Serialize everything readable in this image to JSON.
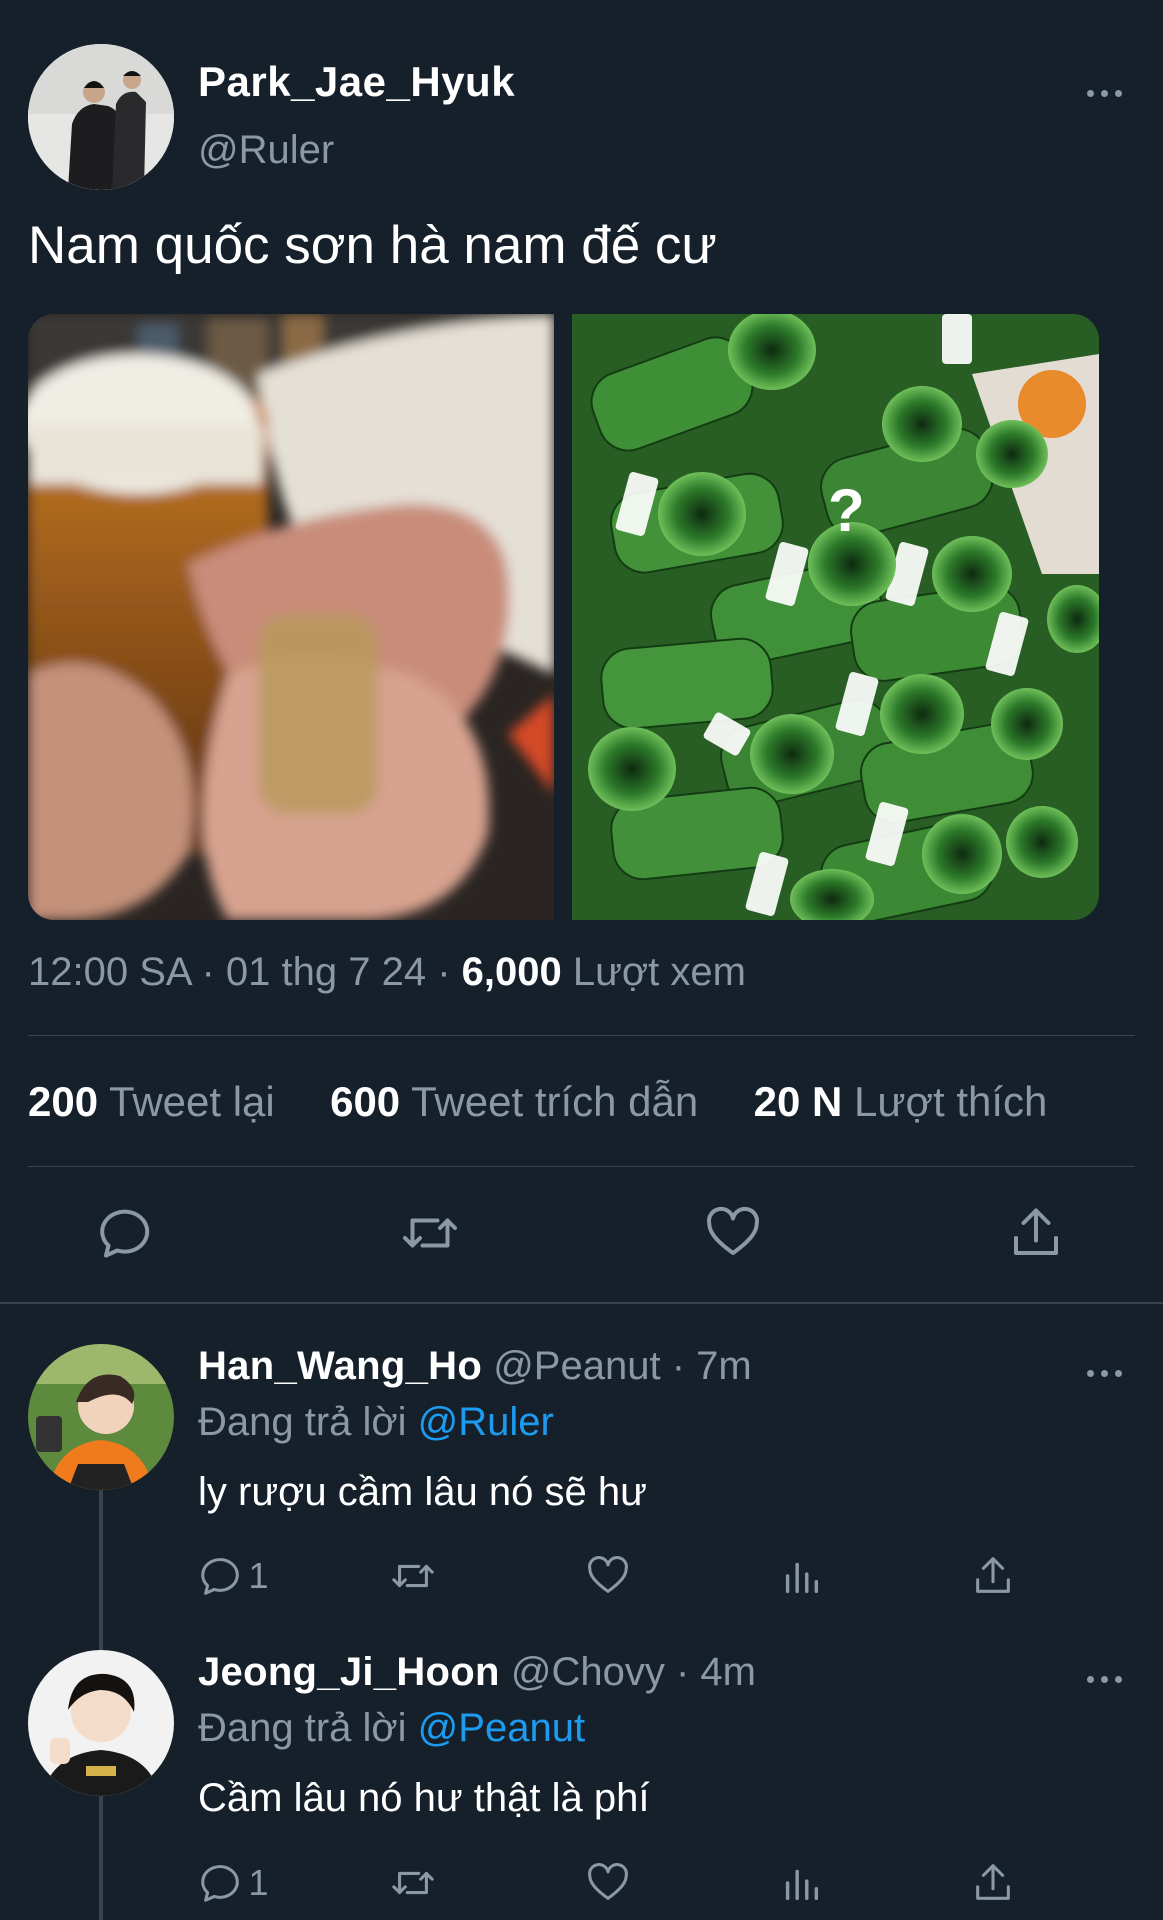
{
  "tweet": {
    "display_name": "Park_Jae_Hyuk",
    "handle": "@Ruler",
    "text": "Nam quốc sơn hà nam đế cư",
    "time": "12:00 SA",
    "date": "01 thg 7 24",
    "views_count": "6,000",
    "views_label": "Lượt xem",
    "retweets_count": "200",
    "retweets_label": "Tweet lại",
    "quotes_count": "600",
    "quotes_label": "Tweet trích dẫn",
    "likes_count": "20 N",
    "likes_label": "Lượt thích",
    "image_overlay": "?"
  },
  "replies": [
    {
      "display_name": "Han_Wang_Ho",
      "handle": "@Peanut",
      "time": "7m",
      "replying_label": "Đang trả lời",
      "replying_to": "@Ruler",
      "text": "ly rượu cầm lâu nó sẽ hư",
      "reply_count": "1"
    },
    {
      "display_name": "Jeong_Ji_Hoon",
      "handle": "@Chovy",
      "time": "4m",
      "replying_label": "Đang trả lời",
      "replying_to": "@Peanut",
      "text": "Cầm lâu nó hư thật là phí",
      "reply_count": "1"
    }
  ],
  "colors": {
    "background": "#15202b",
    "muted": "#8b98a5",
    "link": "#1d9bf0",
    "divider": "#38444d"
  },
  "icons": [
    "comment-icon",
    "retweet-icon",
    "like-icon",
    "share-icon",
    "analytics-icon",
    "more-icon"
  ]
}
